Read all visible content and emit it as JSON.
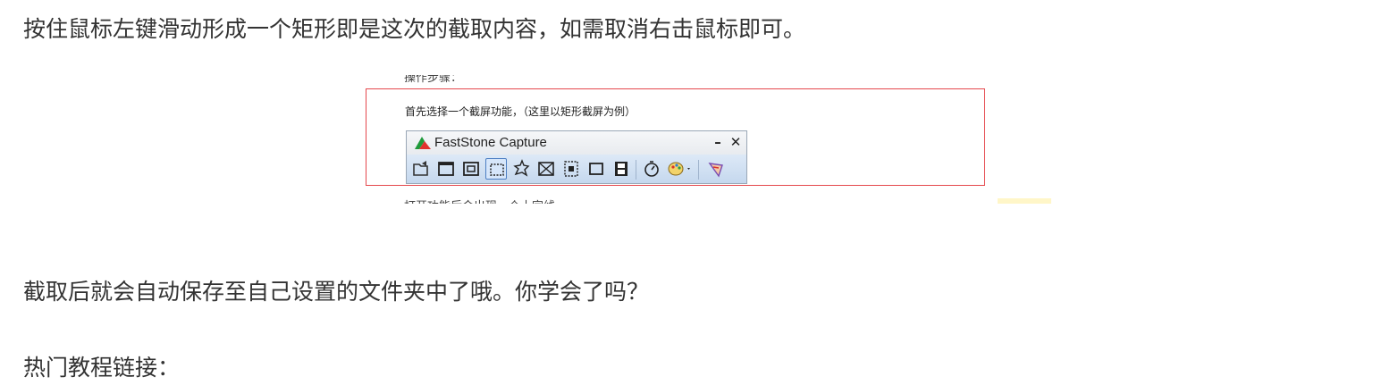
{
  "article": {
    "paragraph_1": "按住鼠标左键滑动形成一个矩形即是这次的截取内容，如需取消右击鼠标即可。",
    "paragraph_2": "截取后就会自动保存至自己设置的文件夹中了哦。你学会了吗？",
    "paragraph_3": "热门教程链接："
  },
  "screenshot": {
    "cut_top_text": "操作步骤：",
    "instruction": "首先选择一个截屏功能，（这里以矩形截屏为例）",
    "cut_bottom_text": "打开功能后会出现一个十字线",
    "highlight_color": "#e5484d",
    "window": {
      "title": "FastStone Capture",
      "minimize_glyph": "–",
      "close_glyph": "✕"
    },
    "toolbar_icons": [
      "open-folder-icon",
      "capture-window-icon",
      "capture-object-icon",
      "capture-rectangle-icon",
      "capture-freehand-icon",
      "capture-fullscreen-icon",
      "capture-scrolling-icon",
      "capture-fixed-region-icon",
      "screen-recorder-icon",
      "delay-timer-icon",
      "output-destination-icon",
      "settings-icon"
    ],
    "active_tool": "capture-rectangle-icon"
  }
}
